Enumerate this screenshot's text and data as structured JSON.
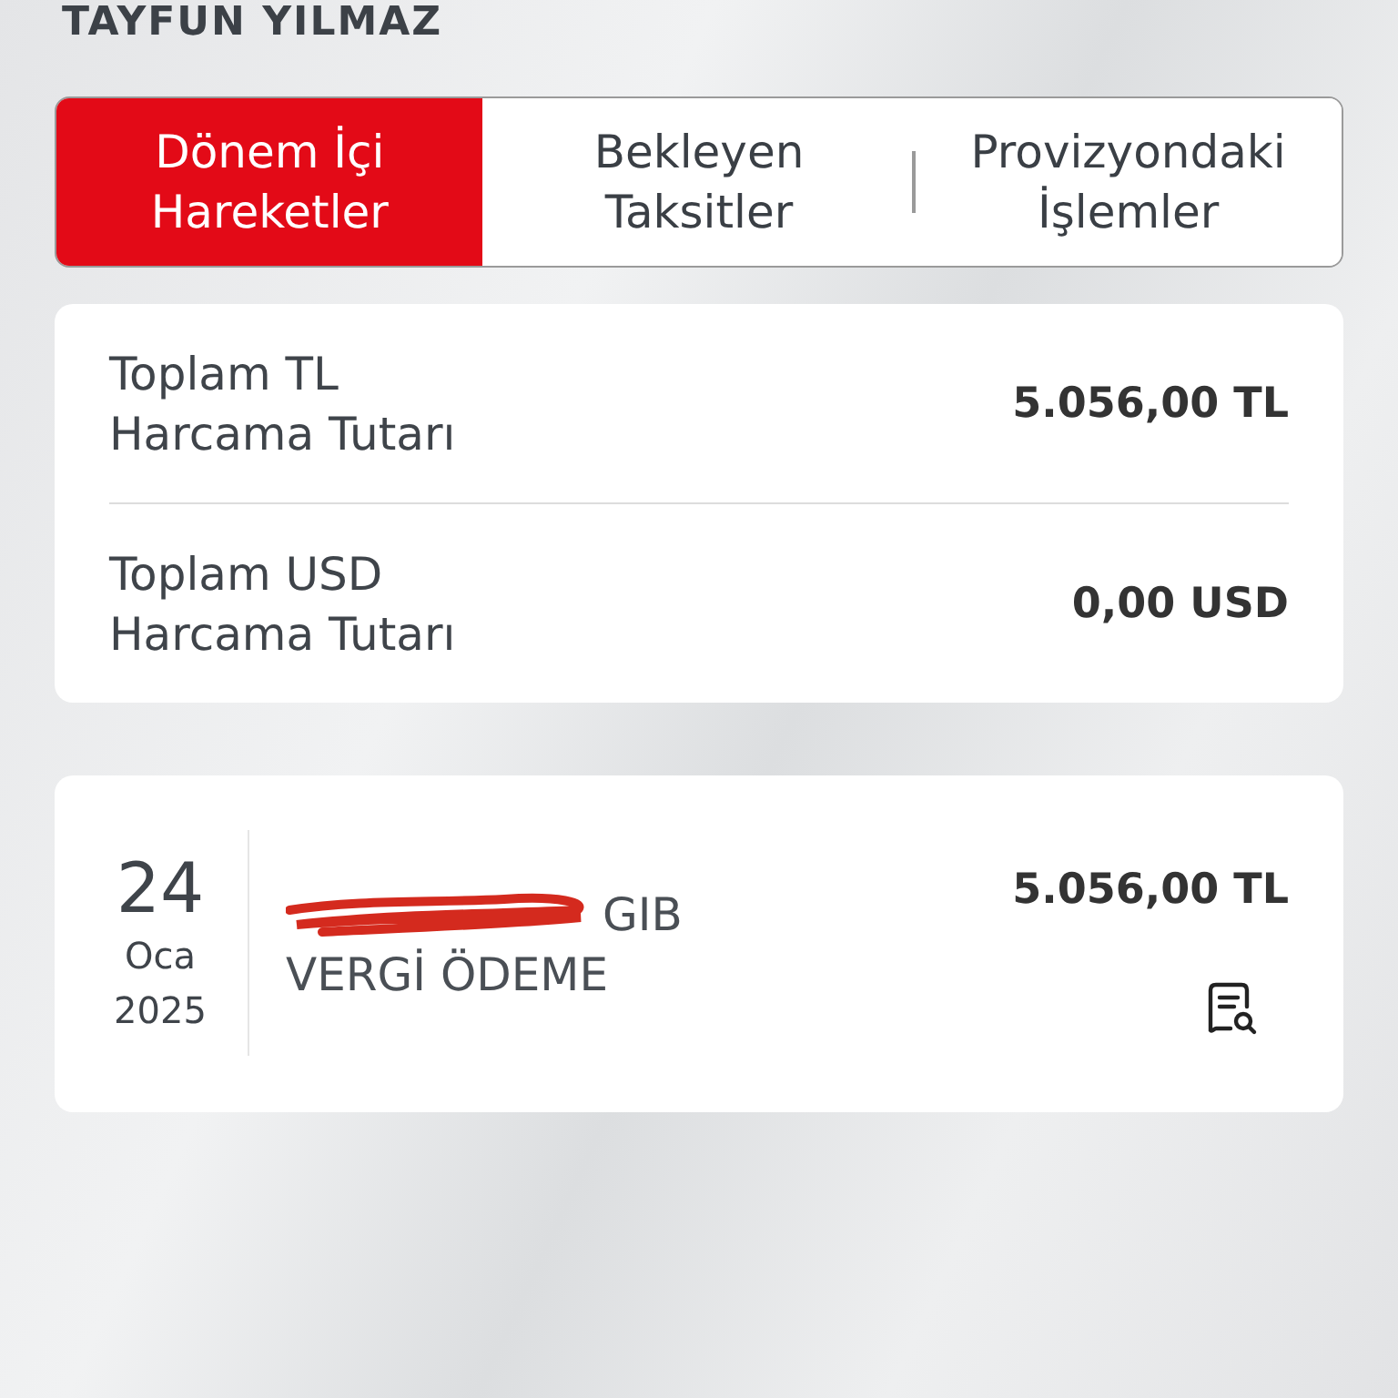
{
  "header": {
    "name": "TAYFUN YILMAZ"
  },
  "tabs": [
    {
      "label": "Dönem İçi\nHareketler",
      "selected": true
    },
    {
      "label": "Bekleyen\nTaksitler",
      "selected": false
    },
    {
      "label": "Provizyondaki\nİşlemler",
      "selected": false
    }
  ],
  "totals": [
    {
      "label": "Toplam TL\nHarcama Tutarı",
      "amount": "5.056,00 TL"
    },
    {
      "label": "Toplam USD\nHarcama Tutarı",
      "amount": "0,00 USD"
    }
  ],
  "transactions": [
    {
      "day": "24",
      "month": "Oca",
      "year": "2025",
      "reference_suffix": "GIB",
      "redacted": true,
      "description": "VERGİ ÖDEME",
      "amount": "5.056,00 TL"
    }
  ]
}
